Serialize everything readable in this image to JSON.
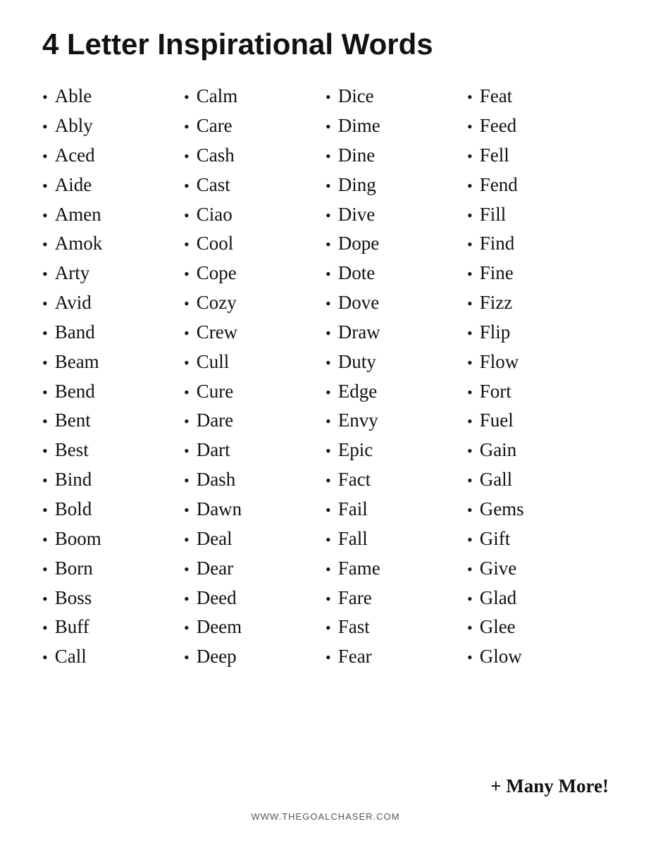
{
  "title": "4 Letter Inspirational Words",
  "columns": [
    {
      "words": [
        "Able",
        "Ably",
        "Aced",
        "Aide",
        "Amen",
        "Amok",
        "Arty",
        "Avid",
        "Band",
        "Beam",
        "Bend",
        "Bent",
        "Best",
        "Bind",
        "Bold",
        "Boom",
        "Born",
        "Boss",
        "Buff",
        "Call"
      ]
    },
    {
      "words": [
        "Calm",
        "Care",
        "Cash",
        "Cast",
        "Ciao",
        "Cool",
        "Cope",
        "Cozy",
        "Crew",
        "Cull",
        "Cure",
        "Dare",
        "Dart",
        "Dash",
        "Dawn",
        "Deal",
        "Dear",
        "Deed",
        "Deem",
        "Deep"
      ]
    },
    {
      "words": [
        "Dice",
        "Dime",
        "Dine",
        "Ding",
        "Dive",
        "Dope",
        "Dote",
        "Dove",
        "Draw",
        "Duty",
        "Edge",
        "Envy",
        "Epic",
        "Fact",
        "Fail",
        "Fall",
        "Fame",
        "Fare",
        "Fast",
        "Fear"
      ]
    },
    {
      "words": [
        "Feat",
        "Feed",
        "Fell",
        "Fend",
        "Fill",
        "Find",
        "Fine",
        "Fizz",
        "Flip",
        "Flow",
        "Fort",
        "Fuel",
        "Gain",
        "Gall",
        "Gems",
        "Gift",
        "Give",
        "Glad",
        "Glee",
        "Glow"
      ]
    }
  ],
  "many_more": "+ Many More!",
  "footer": "WWW.THEGOALCHASER.COM",
  "bullet": "•"
}
